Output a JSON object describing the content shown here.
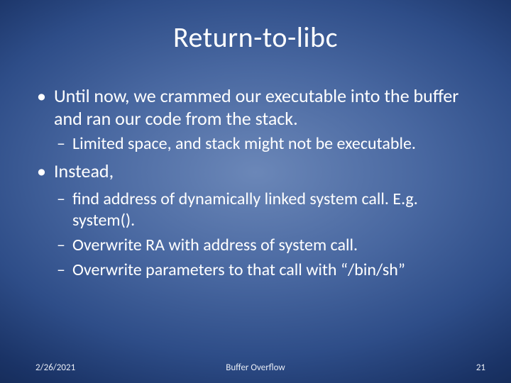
{
  "slide": {
    "title": "Return-to-libc",
    "bullets": {
      "b1_1": "Until now, we crammed our executable into the buffer and ran our code from the stack.",
      "b2_1": "Limited space, and stack might not be executable.",
      "b1_2": "Instead,",
      "b2_2": "find address of dynamically linked system call.  E.g. system().",
      "b2_3": "Overwrite RA with address of system call.",
      "b2_4": "Overwrite parameters to that call with “/bin/sh”"
    },
    "footer": {
      "date": "2/26/2021",
      "center": "Buffer Overflow",
      "page": "21"
    }
  }
}
